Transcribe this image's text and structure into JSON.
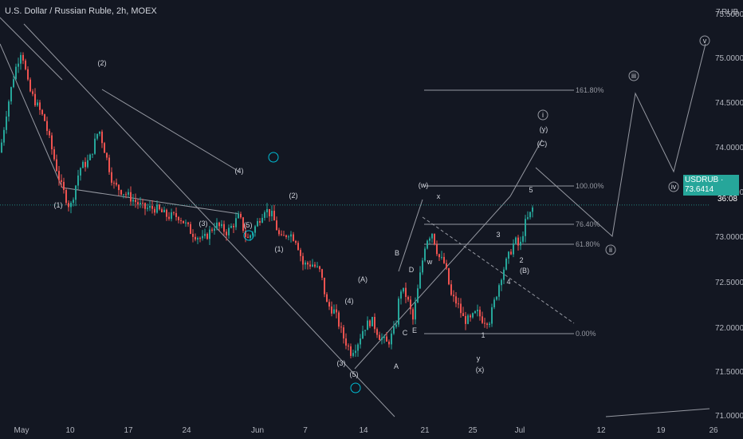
{
  "header": {
    "title": "U.S. Dollar / Russian Ruble, 2h, MOEX"
  },
  "price_tag": {
    "symbol": "USDRUB",
    "price": "73.6414",
    "countdown": "36:08"
  },
  "colors": {
    "up": "#26a69a",
    "down": "#ef5350",
    "line": "#9598a1",
    "accent": "#00bcd4"
  },
  "chart_data": {
    "type": "candlestick",
    "currency": "RUB",
    "y_ticks": [
      "71.0000",
      "71.5000",
      "72.0000",
      "72.5000",
      "73.0000",
      "73.5000",
      "74.0000",
      "74.5000",
      "75.0000",
      "75.5000",
      "7"
    ],
    "ylim": [
      71.0,
      76.05
    ],
    "x_ticks": [
      "May",
      "10",
      "17",
      "24",
      "Jun",
      "7",
      "14",
      "21",
      "25",
      "Jul",
      "12",
      "19",
      "26"
    ],
    "fib_levels": [
      {
        "label": "161.80%",
        "value": 75.08
      },
      {
        "label": "100.00%",
        "value": 73.88
      },
      {
        "label": "76.40%",
        "value": 73.4
      },
      {
        "label": "61.80%",
        "value": 73.15
      },
      {
        "label": "0.00%",
        "value": 72.03
      }
    ],
    "last_price": 73.6414,
    "wave_labels": [
      "(1)",
      "(2)",
      "(3)",
      "(4)",
      "(5)",
      "(1)",
      "(2)",
      "(3)",
      "(4)",
      "(5)",
      "A",
      "B",
      "C",
      "D",
      "E",
      "(A)",
      "(B)",
      "(C)",
      "(w)",
      "(x)",
      "(y)",
      "x",
      "w",
      "y",
      "1",
      "2",
      "3",
      "4",
      "5",
      "i",
      "ii",
      "iii",
      "iv",
      "v"
    ]
  }
}
